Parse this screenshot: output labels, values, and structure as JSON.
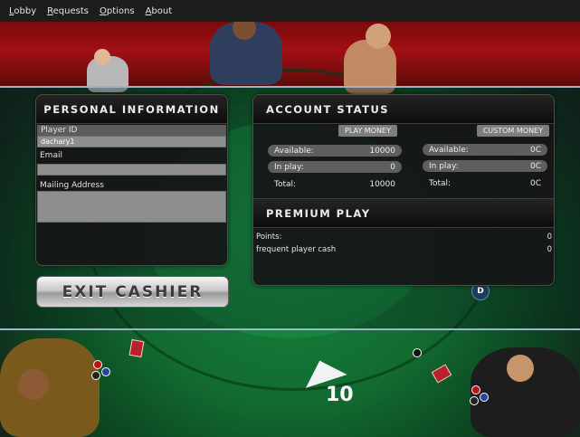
{
  "menu": {
    "items": [
      {
        "accel": "L",
        "rest": "obby"
      },
      {
        "accel": "R",
        "rest": "equests"
      },
      {
        "accel": "O",
        "rest": "ptions"
      },
      {
        "accel": "A",
        "rest": "bout"
      }
    ]
  },
  "personal": {
    "title": "Personal Information",
    "player_id_label": "Player ID",
    "player_id_value": "dachary1",
    "email_label": "Email",
    "email_value": "",
    "mailing_label": "Mailing Address",
    "mailing_value": ""
  },
  "account": {
    "title": "Account Status",
    "play_money_tab": "PLAY MONEY",
    "custom_money_tab": "CUSTOM MONEY",
    "play": {
      "available_label": "Available:",
      "available_value": "10000",
      "inplay_label": "In play:",
      "inplay_value": "0",
      "total_label": "Total:",
      "total_value": "10000"
    },
    "custom": {
      "available_label": "Available:",
      "available_value": "0C",
      "inplay_label": "In play:",
      "inplay_value": "0C",
      "total_label": "Total:",
      "total_value": "0C"
    }
  },
  "premium": {
    "title": "Premium Play",
    "points_label": "Points:",
    "points_value": "0",
    "fpc_label": "frequent player cash",
    "fpc_value": "0"
  },
  "exit_button": "Exit Cashier",
  "table": {
    "pot_amount": "10",
    "dealer_button": "D"
  },
  "colors": {
    "felt": "#17803c",
    "rail_red": "#a10f14",
    "panel_bg": "#161616"
  }
}
